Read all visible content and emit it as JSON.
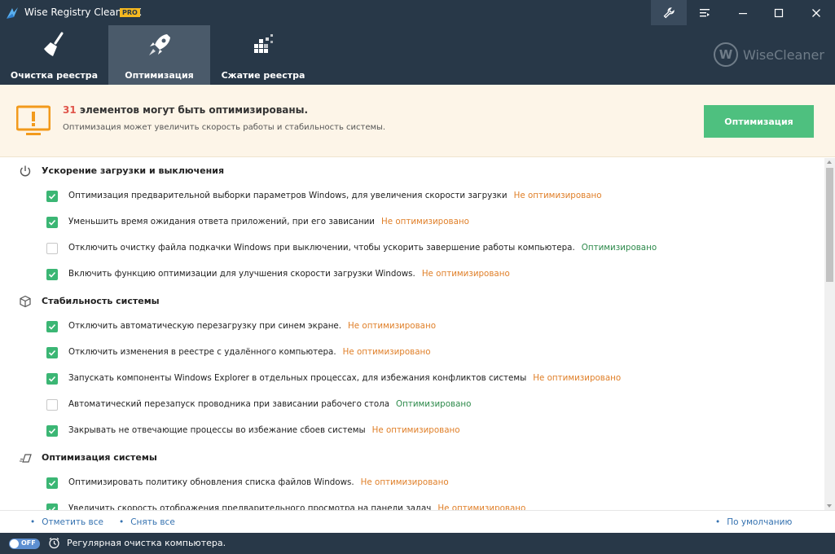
{
  "window": {
    "title": "Wise Registry Cleaner X",
    "badge": "PRO"
  },
  "tabs": [
    {
      "label": "Очистка реестра",
      "icon": "broom-icon"
    },
    {
      "label": "Оптимизация",
      "icon": "rocket-icon",
      "active": true
    },
    {
      "label": "Сжатие реестра",
      "icon": "blocks-icon"
    }
  ],
  "brand": {
    "letter": "W",
    "name": "WiseCleaner"
  },
  "banner": {
    "count": "31",
    "title_rest": " элементов могут быть оптимизированы.",
    "subtitle": "Оптимизация может увеличить скорость работы и стабильность системы.",
    "button": "Оптимизация"
  },
  "sections": [
    {
      "title": "Ускорение загрузки и выключения",
      "icon": "power-icon",
      "items": [
        {
          "checked": true,
          "text": "Оптимизация предварительной выборки параметров Windows, для увеличения скорости загрузки",
          "status": "Не оптимизировано"
        },
        {
          "checked": true,
          "text": "Уменьшить время ожидания ответа приложений, при его зависании",
          "status": "Не оптимизировано"
        },
        {
          "checked": false,
          "text": "Отключить очистку файла подкачки Windows при выключении, чтобы ускорить завершение работы компьютера.",
          "status": "Оптимизировано"
        },
        {
          "checked": true,
          "text": "Включить функцию оптимизации для улучшения скорости загрузки Windows.",
          "status": "Не оптимизировано"
        }
      ]
    },
    {
      "title": "Стабильность системы",
      "icon": "cube-icon",
      "items": [
        {
          "checked": true,
          "text": "Отключить автоматическую перезагрузку при синем экране.",
          "status": "Не оптимизировано"
        },
        {
          "checked": true,
          "text": "Отключить изменения в реестре с удалённого компьютера.",
          "status": "Не оптимизировано"
        },
        {
          "checked": true,
          "text": "Запускать компоненты Windows Explorer в отдельных процессах, для избежания конфликтов системы",
          "status": "Не оптимизировано"
        },
        {
          "checked": false,
          "text": "Автоматический перезапуск проводника при зависании рабочего стола",
          "status": "Оптимизировано"
        },
        {
          "checked": true,
          "text": "Закрывать не отвечающие процессы во избежание сбоев системы",
          "status": "Не оптимизировано"
        }
      ]
    },
    {
      "title": "Оптимизация системы",
      "icon": "speed-icon",
      "items": [
        {
          "checked": true,
          "text": "Оптимизировать политику обновления списка файлов Windows.",
          "status": "Не оптимизировано"
        },
        {
          "checked": true,
          "text": "Увеличить скорость отображения предварительного просмотра на панели задач",
          "status": "Не оптимизировано"
        }
      ]
    }
  ],
  "footer": {
    "select_all": "Отметить все",
    "deselect_all": "Снять все",
    "default": "По умолчанию"
  },
  "statusbar": {
    "toggle": "OFF",
    "text": "Регулярная очистка компьютера."
  },
  "colors": {
    "dark": "#283848",
    "accent_green": "#4ec07f",
    "not_optimized": "#e0802a",
    "optimized": "#2d8a4b",
    "count": "#e0554b"
  }
}
